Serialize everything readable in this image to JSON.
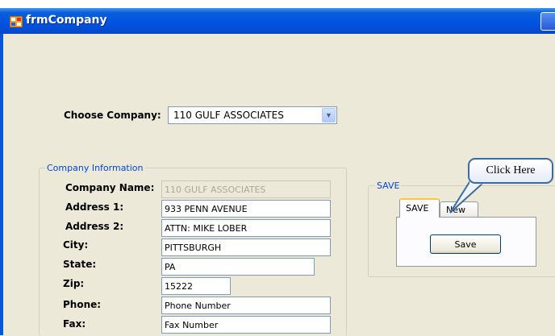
{
  "window": {
    "title": "frmCompany"
  },
  "choose_company": {
    "label": "Choose Company:",
    "selected": "110 GULF ASSOCIATES"
  },
  "company_info": {
    "legend": "Company Information",
    "fields": [
      {
        "label": "Company Name:",
        "value": "110 GULF ASSOCIATES",
        "disabled": true
      },
      {
        "label": "Address 1:",
        "value": "933 PENN AVENUE"
      },
      {
        "label": "Address 2:",
        "value": "ATTN: MIKE LOBER"
      },
      {
        "label": "City:",
        "value": "PITTSBURGH"
      },
      {
        "label": "State:",
        "value": "PA"
      },
      {
        "label": "Zip:",
        "value": "15222"
      },
      {
        "label": "Phone:",
        "value": "Phone Number"
      },
      {
        "label": "Fax:",
        "value": "Fax Number"
      }
    ]
  },
  "save_group": {
    "legend": "SAVE",
    "tabs": [
      {
        "label": "SAVE",
        "active": true
      },
      {
        "label": "New",
        "active": false
      }
    ],
    "save_button": "Save"
  },
  "callout": {
    "text": "Click Here"
  }
}
